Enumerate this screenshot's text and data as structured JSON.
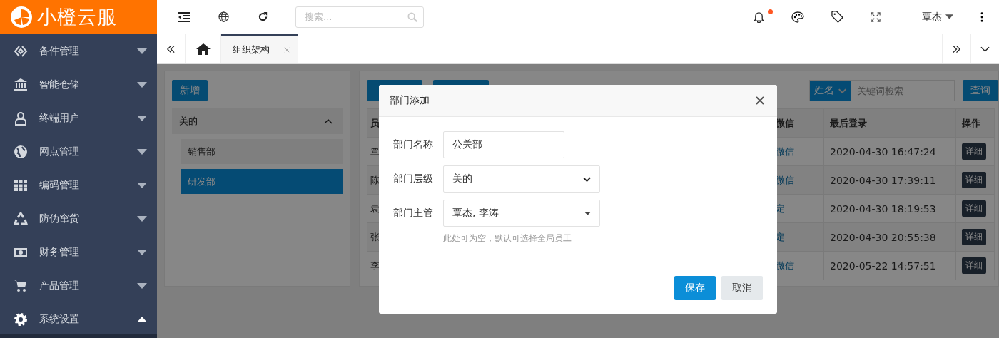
{
  "app": {
    "logo": "小橙云服"
  },
  "sidebar": {
    "items": [
      {
        "label": "备件管理",
        "expanded": false
      },
      {
        "label": "智能仓储",
        "expanded": false
      },
      {
        "label": "终端用户",
        "expanded": false
      },
      {
        "label": "网点管理",
        "expanded": false
      },
      {
        "label": "编码管理",
        "expanded": false
      },
      {
        "label": "防伪窜货",
        "expanded": false
      },
      {
        "label": "财务管理",
        "expanded": false
      },
      {
        "label": "产品管理",
        "expanded": false
      },
      {
        "label": "系统设置",
        "expanded": true
      }
    ]
  },
  "header": {
    "search": {
      "placeholder": "搜索..."
    },
    "notification_dot": true,
    "user": "覃杰"
  },
  "tabs": [
    {
      "label": "组织架构",
      "selected": true
    }
  ],
  "dept_tree": {
    "add_button": "新增",
    "root": {
      "label": "美的",
      "expanded": true,
      "children": [
        {
          "label": "销售部",
          "selected": false
        },
        {
          "label": "研发部",
          "selected": true
        }
      ]
    }
  },
  "staff": {
    "search": {
      "field": "姓名",
      "placeholder": "关键词检索",
      "button": "查询"
    },
    "table": {
      "columns": [
        "员",
        "微信",
        "最后登录",
        "操作"
      ],
      "rows": [
        {
          "column_1": "覃",
          "wechat": "微信",
          "last_login": "2020-04-30 16:47:24",
          "action": "详细"
        },
        {
          "column_1": "陈",
          "wechat": "微信",
          "last_login": "2020-04-30 17:39:11",
          "action": "详细"
        },
        {
          "column_1": "袁",
          "wechat": "定",
          "last_login": "2020-04-30 18:19:53",
          "action": "详细"
        },
        {
          "column_1": "张",
          "wechat": "定",
          "last_login": "2020-04-30 20:55:38",
          "action": "详细"
        },
        {
          "column_1": "李",
          "wechat": "微信",
          "last_login": "2020-05-22 14:57:51",
          "action": "详细"
        }
      ]
    }
  },
  "dialog": {
    "title": "部门添加",
    "fields": [
      {
        "label": "部门名称",
        "kind": "text",
        "value": "公关部"
      },
      {
        "label": "部门层级",
        "kind": "select",
        "value": "美的"
      },
      {
        "label": "部门主管",
        "kind": "multiselect",
        "value": "覃杰, 李涛",
        "hint": "此处可为空，默认可选择全局员工"
      }
    ],
    "buttons": [
      {
        "label": "保存",
        "kind": "primary"
      },
      {
        "label": "取消",
        "kind": "secondary"
      }
    ]
  }
}
